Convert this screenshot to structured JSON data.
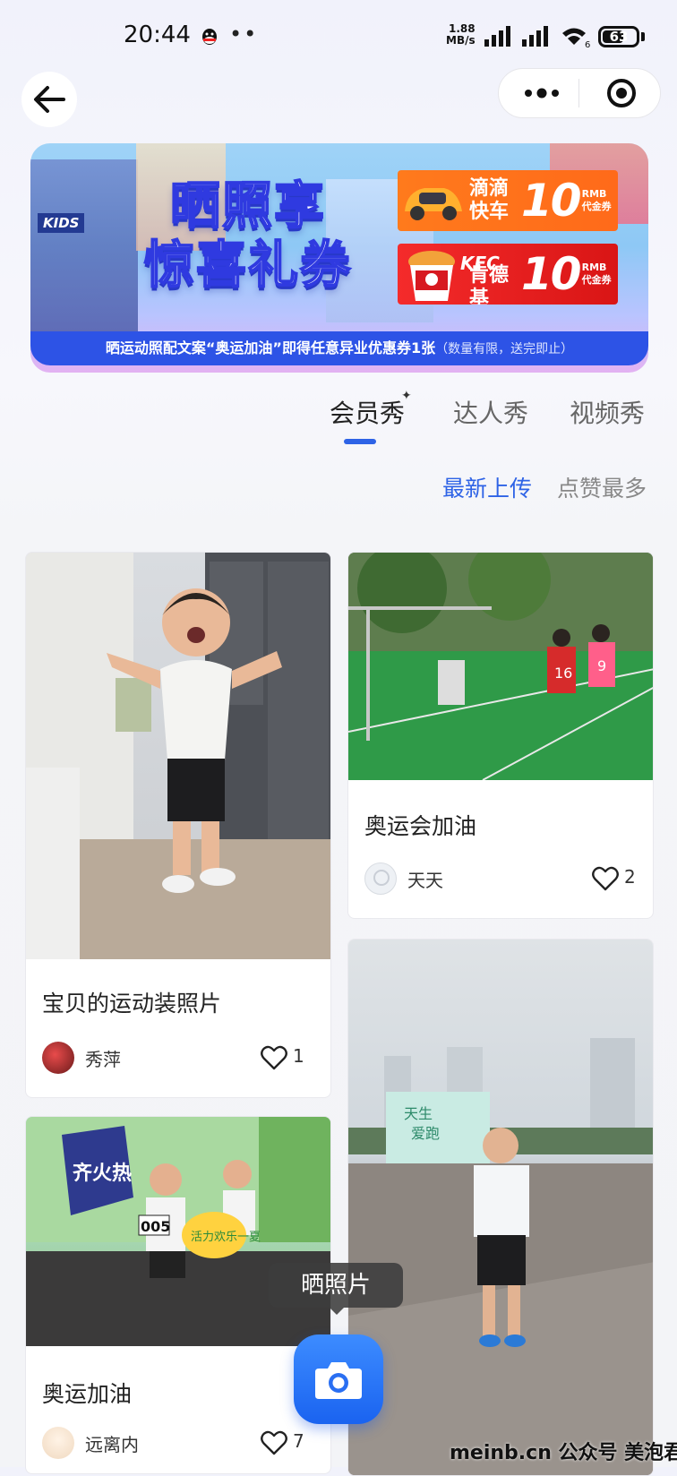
{
  "status_bar": {
    "time": "20:44",
    "network_speed_value": "1.88",
    "network_speed_unit": "MB/s",
    "wifi_label": "6",
    "battery_percent": 63
  },
  "banner": {
    "kids_logo": "KIDS",
    "title_line1": "晒照享",
    "title_line2": "惊喜礼券",
    "coupons": [
      {
        "brand_line1": "滴滴",
        "brand_line2": "快车",
        "value": "10",
        "unit": "RMB",
        "type": "代金券"
      },
      {
        "brand_logo": "KFC",
        "brand_line1": "肯德基",
        "value": "10",
        "unit": "RMB",
        "type": "代金券"
      }
    ],
    "footer_text": "晒运动照配文案“奥运加油”即得任意异业优惠券1张",
    "footer_note": "（数量有限，送完即止）"
  },
  "tabs": [
    {
      "label": "会员秀",
      "active": true
    },
    {
      "label": "达人秀",
      "active": false
    },
    {
      "label": "视频秀",
      "active": false
    }
  ],
  "sort_options": [
    {
      "label": "最新上传",
      "active": true
    },
    {
      "label": "点赞最多",
      "active": false
    }
  ],
  "posts": [
    {
      "title": "宝贝的运动装照片",
      "user": "秀萍",
      "likes": "1"
    },
    {
      "title": "奥运会加油",
      "user": "天天",
      "likes": "2"
    },
    {
      "title": "奥运加油",
      "user": "远离内",
      "likes": "7"
    },
    {
      "title": "",
      "user": "",
      "likes": ""
    }
  ],
  "photo_4_signs": {
    "sign_top": "天生",
    "sign_bottom": "爱跑"
  },
  "photo_3_signs": {
    "event_logo": "齐火热",
    "bib": "005",
    "sign_text": "活力欢乐一夏"
  },
  "photo_2_jerseys": [
    "16",
    "9"
  ],
  "fab": {
    "tooltip": "晒照片",
    "icon": "camera-icon"
  },
  "watermark": "meinb.cn  公众号 美泡君",
  "colors": {
    "accent": "#2e63e6",
    "banner_footer": "#2d53e6",
    "didi": "#ff7a1c",
    "kfc": "#e11b1b"
  }
}
